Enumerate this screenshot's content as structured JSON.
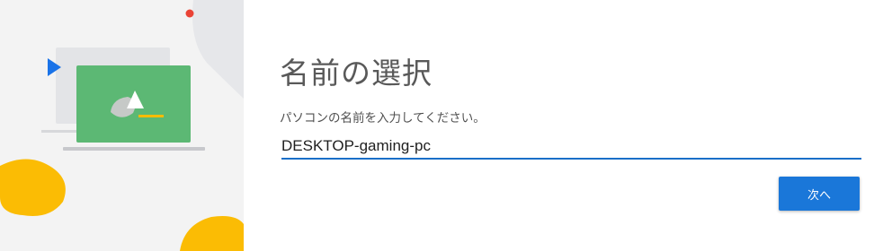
{
  "dialog": {
    "title": "名前の選択",
    "instruction": "パソコンの名前を入力してください。"
  },
  "name_input": {
    "value": "DESKTOP-gaming-pc"
  },
  "buttons": {
    "next_label": "次へ"
  },
  "illustration": {
    "icons": [
      "laptop-illustration-icon",
      "play-arrow-icon",
      "mountain-image-icon"
    ],
    "colors": {
      "panel_bg": "#f3f3f3",
      "card_green": "#5cb874",
      "accent_blue": "#1a73e8",
      "accent_yellow": "#fbbc04",
      "dot_red": "#ea4335"
    }
  },
  "colors": {
    "primary_button": "#1a77d9",
    "input_underline": "#1a6fc8"
  }
}
